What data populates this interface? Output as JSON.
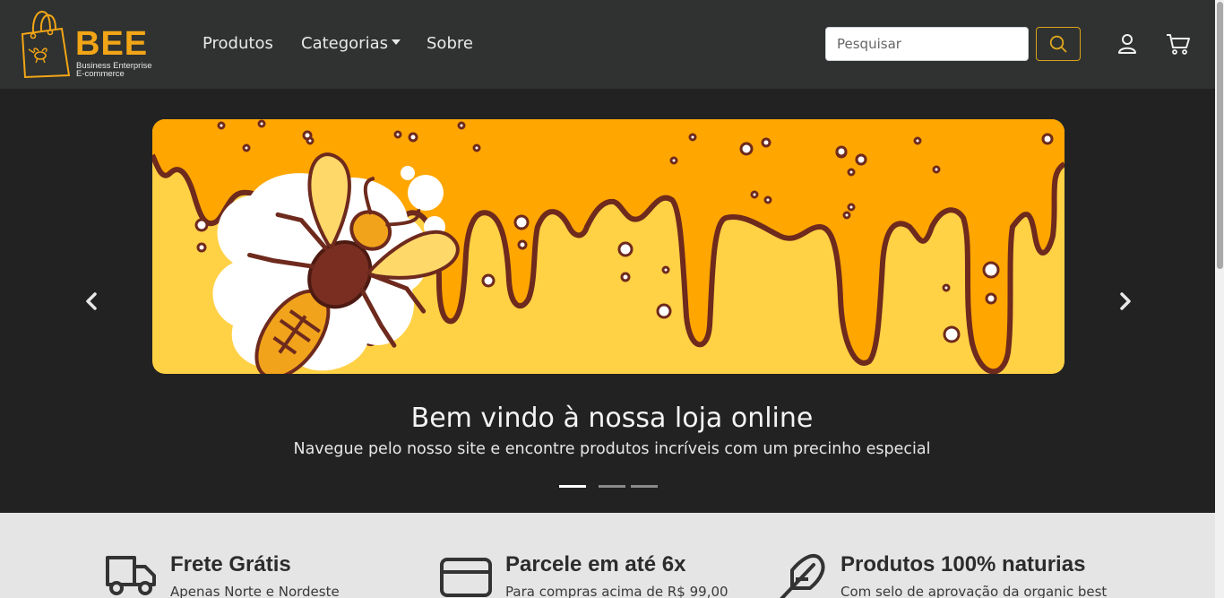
{
  "brand": {
    "name": "BEE",
    "subtitle_lines": [
      "Business Enterprise",
      "E-commerce"
    ],
    "accent_color": "#f2a516"
  },
  "nav": {
    "links": [
      {
        "label": "Produtos"
      },
      {
        "label": "Categorias"
      },
      {
        "label": "Sobre"
      }
    ]
  },
  "search": {
    "placeholder": "Pesquisar",
    "value": "",
    "button_icon": "search-icon"
  },
  "header_icons": [
    "user-icon",
    "cart-icon"
  ],
  "hero": {
    "title": "Bem vindo à nossa loja online",
    "subtitle": "Navegue pelo nosso site e encontre produtos incríveis com um precinho especial",
    "slide_count": 3,
    "active_slide": 1,
    "prev_icon": "chevron-left-icon",
    "next_icon": "chevron-right-icon"
  },
  "features": [
    {
      "icon": "truck-icon",
      "title": "Frete Grátis",
      "description": "Apenas Norte e Nordeste"
    },
    {
      "icon": "credit-card-icon",
      "title": "Parcele em até 6x",
      "description": "Para compras acima de R$ 99,00"
    },
    {
      "icon": "feather-icon",
      "title": "Produtos 100% naturias",
      "description": "Com selo de aprovação da organic best"
    }
  ]
}
